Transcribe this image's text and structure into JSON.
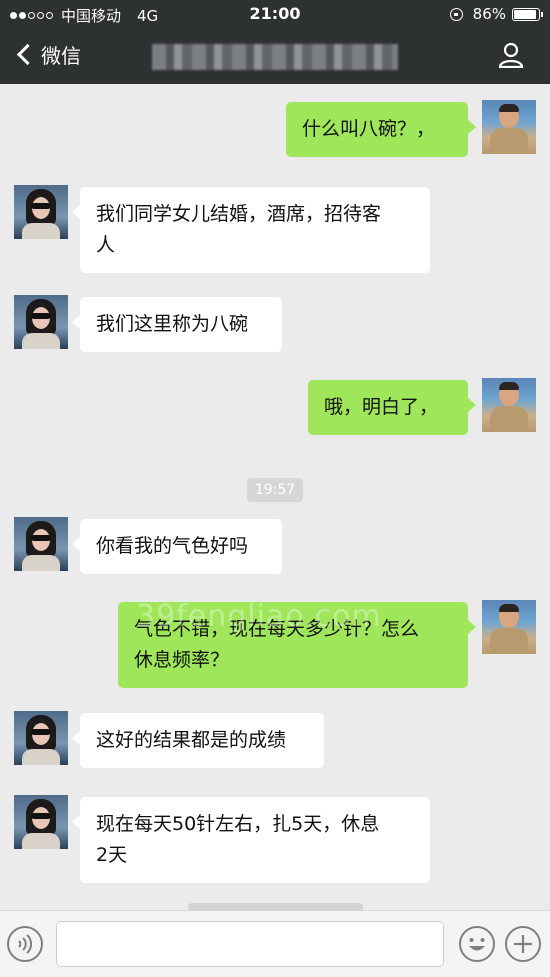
{
  "status_bar": {
    "carrier": "中国移动",
    "network": "4G",
    "time": "21:00",
    "battery": "86%"
  },
  "nav": {
    "back_label": "微信",
    "title": ""
  },
  "messages": [
    {
      "sender": "self",
      "text": "什么叫八碗？，"
    },
    {
      "sender": "other",
      "lines": [
        "我们同学女儿结婚，酒席，招待客",
        "人"
      ]
    },
    {
      "sender": "other",
      "text": "我们这里称为八碗"
    },
    {
      "sender": "self",
      "text": "哦，明白了，"
    },
    {
      "sender": "other",
      "text": "你看我的气色好吗"
    },
    {
      "sender": "self",
      "lines": [
        "气色不错，现在每天多少针？怎么",
        "休息频率？"
      ]
    },
    {
      "sender": "other",
      "text": "这好的结果都是的成绩"
    },
    {
      "sender": "other",
      "lines": [
        "现在每天50针左右，扎5天，休息",
        "2天"
      ]
    }
  ],
  "timestamp": "19:57",
  "watermark": "39fengliao.com",
  "input": {
    "value": "",
    "placeholder": ""
  },
  "icons": {
    "back": "chevron-left-icon",
    "profile": "person-icon",
    "voice": "voice-icon",
    "emoji": "emoji-icon",
    "plus": "plus-icon"
  },
  "colors": {
    "header_bg": "#2e3132",
    "chat_bg": "#ebebeb",
    "self_bubble": "#9fe65a",
    "other_bubble": "#ffffff"
  }
}
